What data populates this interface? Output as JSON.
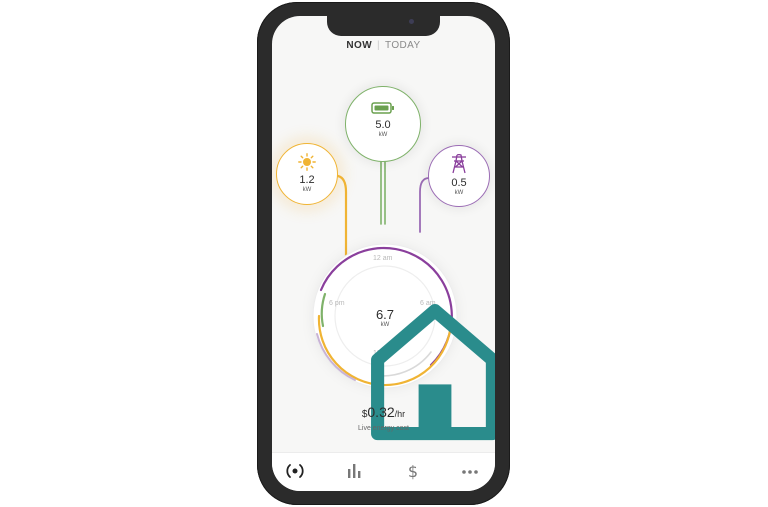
{
  "tabs": {
    "now": "NOW",
    "separator": "|",
    "today": "TODAY"
  },
  "sources": {
    "solar": {
      "value": "1.2",
      "unit": "kW",
      "icon": "sun-icon",
      "color": "#f0b434"
    },
    "battery": {
      "value": "5.0",
      "unit": "kW",
      "icon": "battery-icon",
      "color": "#7fb26a"
    },
    "grid": {
      "value": "0.5",
      "unit": "kW",
      "icon": "power-tower-icon",
      "color": "#9b6cb5"
    }
  },
  "home": {
    "value": "6.7",
    "unit": "kW",
    "icon": "house-icon",
    "clock_labels": {
      "top": "12 am",
      "right": "6 am",
      "bottom": "12 pm",
      "left": "6 pm"
    }
  },
  "cost": {
    "currency": "$",
    "amount": "0.32",
    "per": "/hr",
    "label": "Live energy cost"
  },
  "nav": [
    {
      "icon": "live-icon"
    },
    {
      "icon": "bar-chart-icon"
    },
    {
      "icon": "dollar-icon"
    },
    {
      "icon": "more-icon"
    }
  ],
  "colors": {
    "solar": "#f0b434",
    "battery": "#7fb26a",
    "grid": "#8a3f9c",
    "grid_light": "#c8b3d6",
    "teal": "#2a8c8c"
  }
}
